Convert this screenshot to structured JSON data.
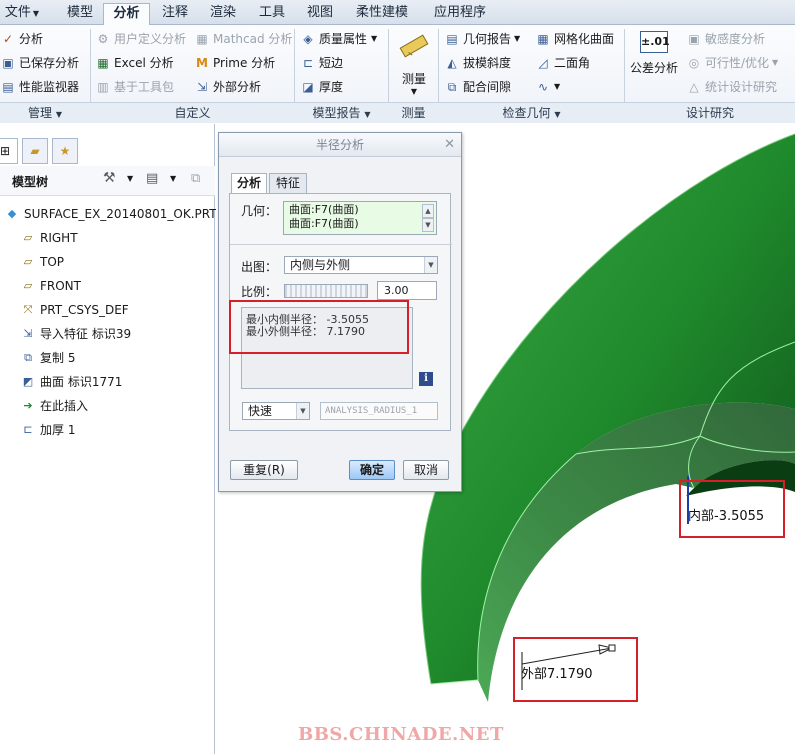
{
  "menu": {
    "file": "文件",
    "tabs": [
      "模型",
      "分析",
      "注释",
      "渲染",
      "工具",
      "视图",
      "柔性建模",
      "应用程序"
    ],
    "active": "分析"
  },
  "ribbon": {
    "manage": {
      "items": [
        "分析",
        "已保存分析",
        "性能监视器"
      ],
      "label": "管理"
    },
    "custom": {
      "items": [
        "用户定义分析",
        "Mathcad 分析",
        "Excel 分析",
        "Prime 分析",
        "基于工具包",
        "外部分析"
      ],
      "label": "自定义"
    },
    "model_report": {
      "items": [
        "质量属性",
        "短边",
        "厚度"
      ],
      "label": "模型报告"
    },
    "measure": {
      "button": "测量",
      "label": "测量"
    },
    "inspect": {
      "items": [
        "几何报告",
        "网格化曲面",
        "拔模斜度",
        "二面角",
        "配合间隙"
      ],
      "label": "检查几何"
    },
    "design_study": {
      "tolerance": "公差分析",
      "tolerance_icon_text": "±.01",
      "items": [
        "敏感度分析",
        "可行性/优化",
        "统计设计研究"
      ],
      "label": "设计研究"
    }
  },
  "tree": {
    "header": "模型树",
    "items": [
      {
        "label": "SURFACE_EX_20140801_OK.PRT",
        "icon": "part-icon"
      },
      {
        "label": "RIGHT",
        "icon": "datum-plane-icon"
      },
      {
        "label": "TOP",
        "icon": "datum-plane-icon"
      },
      {
        "label": "FRONT",
        "icon": "datum-plane-icon"
      },
      {
        "label": "PRT_CSYS_DEF",
        "icon": "csys-icon"
      },
      {
        "label": "导入特征 标识39",
        "icon": "import-feature-icon"
      },
      {
        "label": "复制 5",
        "icon": "copy-feature-icon"
      },
      {
        "label": "曲面 标识1771",
        "icon": "surface-icon"
      },
      {
        "label": "在此插入",
        "icon": "insert-here-icon"
      },
      {
        "label": "加厚 1",
        "icon": "thicken-icon"
      }
    ]
  },
  "dialog": {
    "title": "半径分析",
    "tabs": [
      "分析",
      "特征"
    ],
    "geometry_label": "几何：",
    "geometry_items": [
      "曲面:F7(曲面)",
      "曲面:F7(曲面)"
    ],
    "output_label": "出图：",
    "output_value": "内侧与外侧",
    "ratio_label": "比例：",
    "ratio_value": "3.00",
    "results": [
      "最小内侧半径：  -3.5055",
      "最小外侧半径：  7.1790"
    ],
    "mode_value": "快速",
    "analysis_name": "ANALYSIS_RADIUS_1",
    "buttons": {
      "repeat": "重复(R)",
      "ok": "确定",
      "cancel": "取消"
    }
  },
  "viewport": {
    "annotation_inner": "内部-3.5055",
    "annotation_outer": "外部7.1790",
    "watermark": "BBS.CHINADE.NET"
  },
  "colors": {
    "surface_green": "#1f8a2c",
    "highlight_red": "#d81e28",
    "accent_blue": "#2f4d8c"
  }
}
